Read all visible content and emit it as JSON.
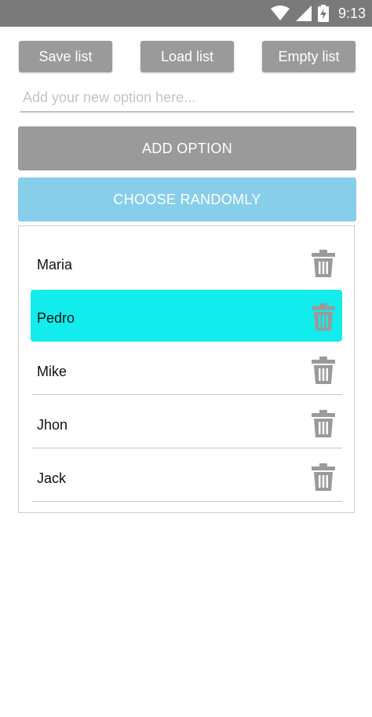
{
  "status_bar": {
    "time": "9:13",
    "icons": [
      "wifi-icon",
      "signal-icon",
      "battery-charging-icon"
    ]
  },
  "toolbar": {
    "save_label": "Save list",
    "load_label": "Load list",
    "empty_label": "Empty list"
  },
  "option_input": {
    "placeholder": "Add your new option here...",
    "value": ""
  },
  "add_button": {
    "label": "ADD OPTION"
  },
  "random_button": {
    "label": "CHOOSE RANDOMLY"
  },
  "options": [
    {
      "name": "Maria",
      "selected": false
    },
    {
      "name": "Pedro",
      "selected": true
    },
    {
      "name": "Mike",
      "selected": false
    },
    {
      "name": "Jhon",
      "selected": false
    },
    {
      "name": "Jack",
      "selected": false
    }
  ],
  "colors": {
    "status_bar": "#7a7a7a",
    "button_gray": "#9a9a9a",
    "random_button": "#87ceeb",
    "selected_item": "#12ecec",
    "trash_icon": "#9a9a9a"
  }
}
